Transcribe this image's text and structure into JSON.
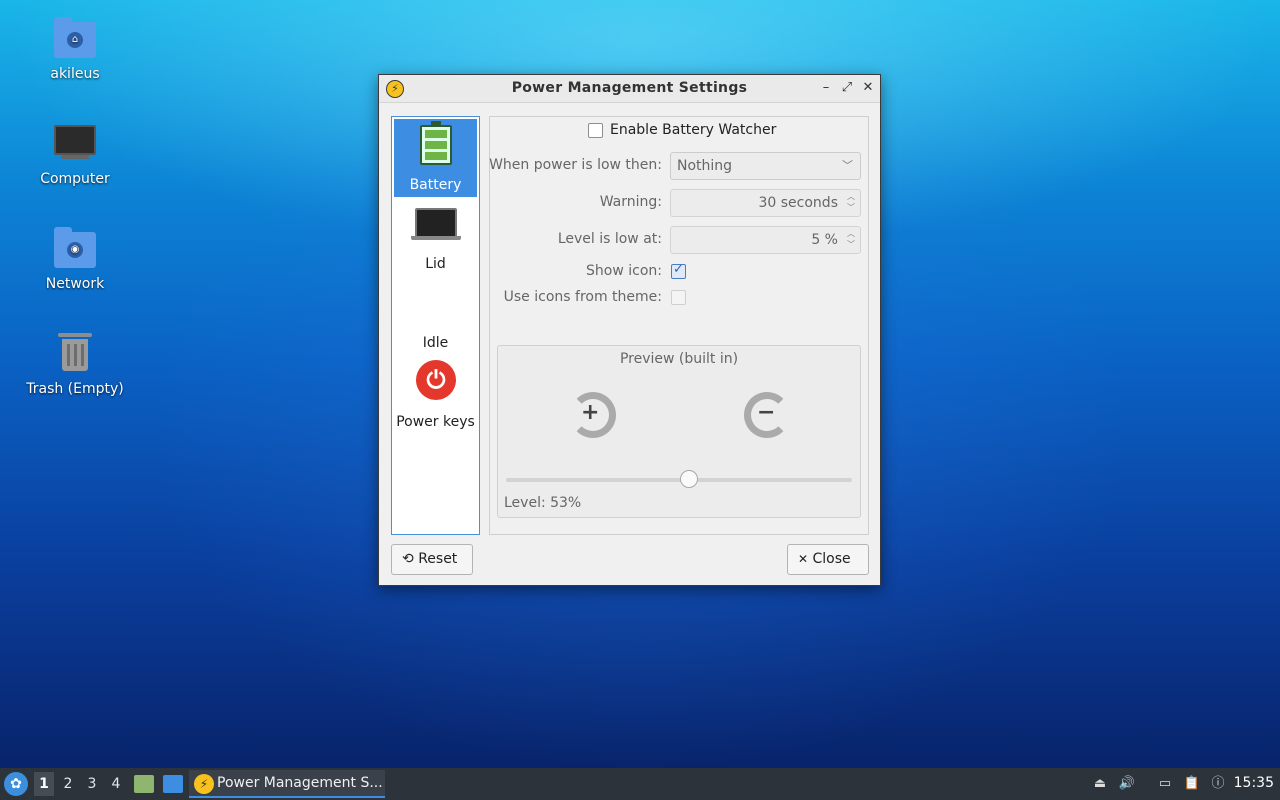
{
  "desktop": {
    "icons": [
      {
        "label": "akileus",
        "icon": "home-folder-icon"
      },
      {
        "label": "Computer",
        "icon": "computer-icon"
      },
      {
        "label": "Network",
        "icon": "network-folder-icon"
      },
      {
        "label": "Trash (Empty)",
        "icon": "trash-icon"
      }
    ]
  },
  "window": {
    "title": "Power Management Settings",
    "app_icon": "lightning-icon",
    "controls": {
      "minimize": "–",
      "maximize": "⤢",
      "close": "✕"
    }
  },
  "sidebar": {
    "items": [
      {
        "label": "Battery",
        "icon": "battery-icon",
        "active": true
      },
      {
        "label": "Lid",
        "icon": "laptop-lid-icon",
        "active": false
      },
      {
        "label": "Idle",
        "icon": "",
        "active": false
      },
      {
        "label": "Power keys",
        "icon": "power-icon",
        "active": false
      }
    ]
  },
  "battery": {
    "enable_watcher_label": "Enable Battery Watcher",
    "enable_watcher_checked": false,
    "low_action_label": "When power is low then:",
    "low_action_value": "Nothing",
    "warning_label": "Warning:",
    "warning_value": "30 seconds",
    "level_low_label": "Level is low at:",
    "level_low_value": "5 %",
    "show_icon_label": "Show icon:",
    "show_icon_checked": true,
    "use_theme_icons_label": "Use icons from theme:",
    "use_theme_icons_checked": false,
    "preview_title": "Preview (built in)",
    "preview_level_text": "Level: 53%",
    "preview_level_value": 53
  },
  "buttons": {
    "reset_icon": "⟲",
    "reset_label": "Reset",
    "close_icon": "✕",
    "close_label": "Close"
  },
  "taskbar": {
    "workspaces": [
      "1",
      "2",
      "3",
      "4"
    ],
    "active_workspace": "1",
    "task_title": "Power Management S...",
    "clock": "15:35"
  }
}
